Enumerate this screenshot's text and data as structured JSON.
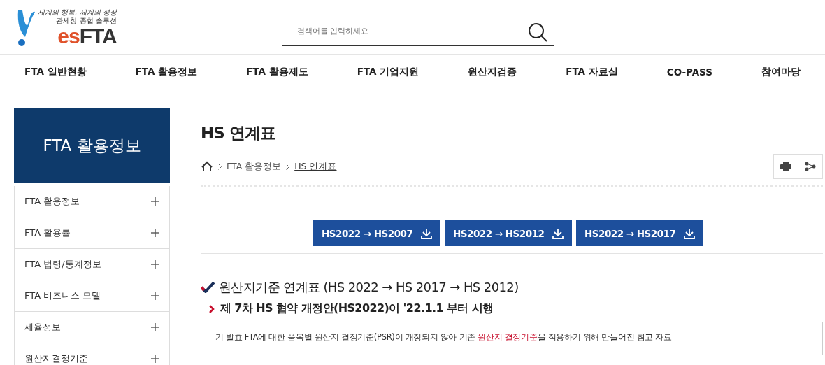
{
  "logo": {
    "tagline": "세계의 행복, 세계의 성장",
    "subtitle": "관세청 종합 솔루션",
    "wordmark_accent": "es",
    "wordmark": "FTA"
  },
  "search": {
    "placeholder": "검색어를 입력하세요"
  },
  "nav": [
    "FTA 일반현황",
    "FTA 활용정보",
    "FTA 활용제도",
    "FTA 기업지원",
    "원산지검증",
    "FTA 자료실",
    "CO-PASS",
    "참여마당"
  ],
  "sidebar": {
    "title": "FTA 활용정보",
    "items": [
      {
        "label": "FTA 활용정보",
        "expanded": false
      },
      {
        "label": "FTA 활용률",
        "expanded": false
      },
      {
        "label": "FTA 법령/통계정보",
        "expanded": false
      },
      {
        "label": "FTA 비즈니스 모델",
        "expanded": false
      },
      {
        "label": "세율정보",
        "expanded": false
      },
      {
        "label": "원산지결정기준",
        "expanded": false
      }
    ]
  },
  "page_title": "HS 연계표",
  "breadcrumb": [
    "FTA 활용정보",
    "HS 연계표"
  ],
  "downloads": [
    "HS2022 → HS2007",
    "HS2022 → HS2012",
    "HS2022 → HS2017"
  ],
  "section_title": "원산지기준 연계표 (HS 2022 → HS 2017 → HS 2012)",
  "subsection_title": "제 7차 HS 협약 개정안(HS2022)이 '22.1.1 부터 시행",
  "note": [
    {
      "text": "기 발효 FTA에 대한 품목별 원산지 결정기준(PSR)이 개정되지 않아 기존 ",
      "highlight": false
    },
    {
      "text": "원산지 결정기준",
      "highlight": true
    },
    {
      "text": "을 적용하기 위해 만들어진 참고 자료",
      "highlight": false
    }
  ]
}
